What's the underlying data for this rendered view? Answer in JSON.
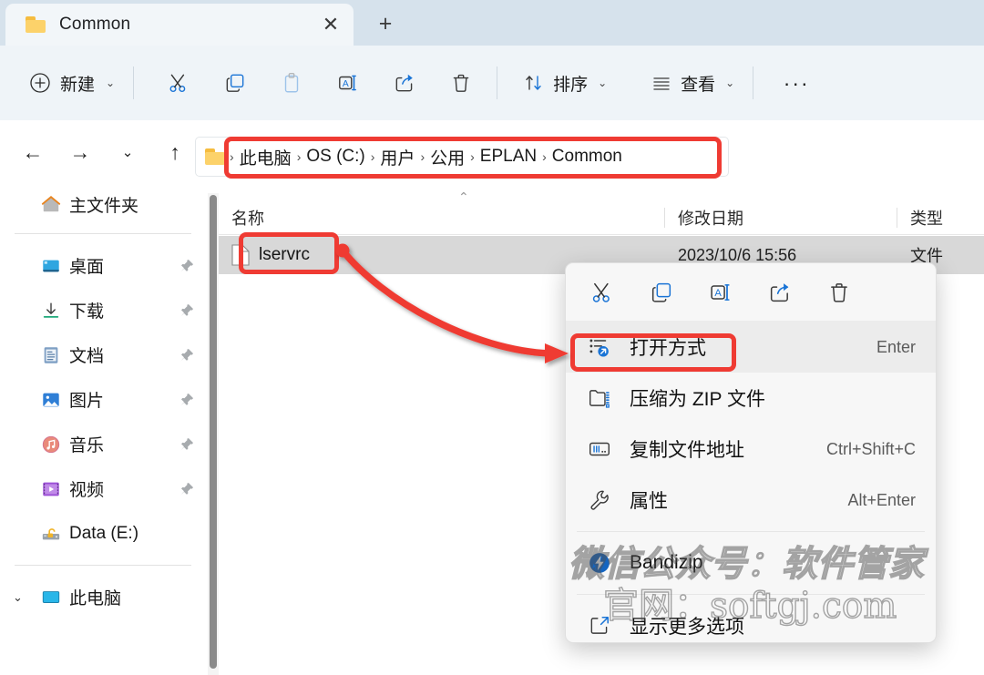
{
  "window": {
    "tab": {
      "title": "Common",
      "folder_icon": "folder-icon",
      "close_icon": "close-icon"
    },
    "new_tab_icon": "plus-icon"
  },
  "toolbar": {
    "new_label": "新建",
    "new_icon": "plus-circle-icon",
    "cut_icon": "scissors-icon",
    "copy_icon": "copy-icon",
    "paste_icon": "clipboard-icon",
    "rename_icon": "rename-icon",
    "share_icon": "share-icon",
    "delete_icon": "trash-icon",
    "sort_label": "排序",
    "sort_icon": "sort-arrows-icon",
    "view_label": "查看",
    "view_icon": "list-lines-icon",
    "more_label": "···",
    "chevron": "⌄"
  },
  "navbar": {
    "back_icon": "arrow-left-icon",
    "forward_icon": "arrow-right-icon",
    "recent_icon": "chevron-down-icon",
    "up_icon": "arrow-up-icon",
    "folder_icon": "folder-icon",
    "breadcrumb_sep": "›",
    "breadcrumbs": [
      {
        "label": "此电脑"
      },
      {
        "label": "OS (C:)"
      },
      {
        "label": "用户"
      },
      {
        "label": "公用"
      },
      {
        "label": "EPLAN"
      },
      {
        "label": "Common"
      }
    ]
  },
  "sidebar": {
    "home": {
      "label": "主文件夹",
      "icon": "home-icon"
    },
    "items": [
      {
        "label": "桌面",
        "icon": "desktop-icon",
        "pinned": true
      },
      {
        "label": "下载",
        "icon": "download-icon",
        "pinned": true
      },
      {
        "label": "文档",
        "icon": "document-icon",
        "pinned": true
      },
      {
        "label": "图片",
        "icon": "pictures-icon",
        "pinned": true
      },
      {
        "label": "音乐",
        "icon": "music-icon",
        "pinned": true
      },
      {
        "label": "视频",
        "icon": "video-icon",
        "pinned": true
      },
      {
        "label": "Data (E:)",
        "icon": "drive-icon",
        "pinned": false
      }
    ],
    "this_pc": {
      "label": "此电脑",
      "icon": "this-pc-icon",
      "chevron": "⌄"
    }
  },
  "filelist": {
    "sort_indicator": "⌃",
    "columns": [
      {
        "label": "名称"
      },
      {
        "label": "修改日期"
      },
      {
        "label": "类型"
      }
    ],
    "rows": [
      {
        "name": "lservrc",
        "date": "2023/10/6 15:56",
        "type": "文件",
        "icon": "file-icon",
        "selected": true
      }
    ]
  },
  "context_menu": {
    "toolbar_icons": [
      {
        "name": "cut-icon"
      },
      {
        "name": "copy-icon"
      },
      {
        "name": "rename-icon"
      },
      {
        "name": "share-icon"
      },
      {
        "name": "delete-icon"
      }
    ],
    "items": [
      {
        "label": "打开方式",
        "accel": "Enter",
        "icon": "open-with-icon",
        "highlighted": true
      },
      {
        "label": "压缩为 ZIP 文件",
        "accel": "",
        "icon": "zip-folder-icon",
        "highlighted": false
      },
      {
        "label": "复制文件地址",
        "accel": "Ctrl+Shift+C",
        "icon": "copy-path-icon",
        "highlighted": false
      },
      {
        "label": "属性",
        "accel": "Alt+Enter",
        "icon": "wrench-icon",
        "highlighted": false
      },
      {
        "label": "Bandizip",
        "accel": "",
        "icon": "bandizip-icon",
        "highlighted": false
      },
      {
        "label": "显示更多选项",
        "accel": "",
        "icon": "show-more-icon",
        "highlighted": false
      }
    ]
  },
  "annotations": {
    "color": "#ef3b33",
    "highlight_address_bar": true,
    "highlight_file": true,
    "highlight_menu_item": true,
    "arrow": "curved-arrow"
  },
  "watermark": {
    "line1": "微信公众号：软件管家",
    "line2": "官网：softgj.com"
  }
}
